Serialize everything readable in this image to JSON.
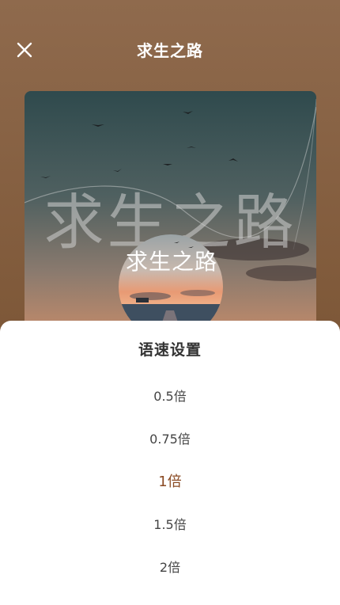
{
  "header": {
    "title": "求生之路",
    "close_icon": "close-icon"
  },
  "cover": {
    "overlay_title": "求生之路",
    "disc_title": "求生之路"
  },
  "speed_sheet": {
    "title": "语速设置",
    "options": [
      "0.5倍",
      "0.75倍",
      "1倍",
      "1.5倍",
      "2倍"
    ],
    "selected_index": 2,
    "selected_color": "#8a4a23"
  }
}
